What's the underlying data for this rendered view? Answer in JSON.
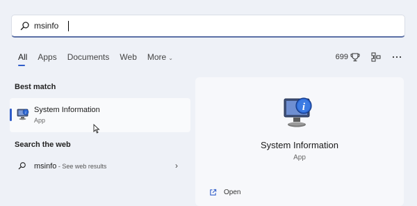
{
  "search": {
    "value": "msinfo",
    "icon": "search-icon"
  },
  "tabs": [
    {
      "label": "All",
      "active": true
    },
    {
      "label": "Apps"
    },
    {
      "label": "Documents"
    },
    {
      "label": "Web"
    },
    {
      "label": "More"
    }
  ],
  "header_right": {
    "points": "699",
    "icons": [
      "rewards-trophy-icon",
      "org-chart-icon",
      "more-icon"
    ]
  },
  "best_match": {
    "heading": "Best match",
    "title": "System Information",
    "subtitle": "App",
    "icon": "system-information-icon"
  },
  "web": {
    "heading": "Search the web",
    "query": "msinfo",
    "suffix": " - See web results"
  },
  "preview": {
    "title": "System Information",
    "subtitle": "App",
    "open_label": "Open"
  },
  "colors": {
    "accent": "#2f5cc9",
    "background": "#eef1f7",
    "panel": "#f7f8fb"
  }
}
